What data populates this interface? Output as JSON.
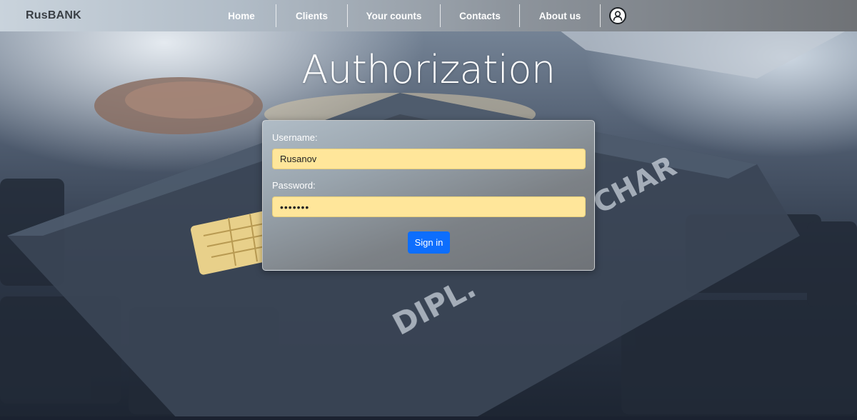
{
  "navbar": {
    "brand": "RusBANK",
    "links": [
      {
        "label": "Home"
      },
      {
        "label": "Clients"
      },
      {
        "label": "Your counts"
      },
      {
        "label": "Contacts"
      },
      {
        "label": "About us"
      }
    ],
    "user_icon": "user-icon"
  },
  "main": {
    "title": "Authorization"
  },
  "login_form": {
    "username_label": "Username:",
    "username_value": "Rusanov",
    "password_label": "Password:",
    "password_value": "•••••••",
    "signin_label": "Sign in"
  },
  "colors": {
    "signin_button": "#0d6efd",
    "input_fill": "#ffe69a"
  }
}
